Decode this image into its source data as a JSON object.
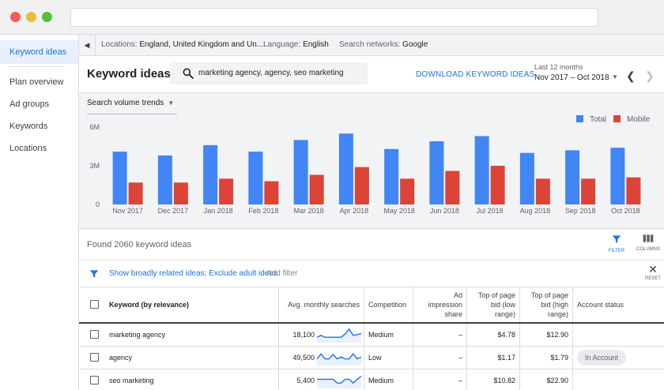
{
  "sidebar": {
    "items": [
      {
        "label": "Keyword ideas",
        "active": true
      },
      {
        "label": "Plan overview"
      },
      {
        "label": "Ad groups"
      },
      {
        "label": "Keywords"
      },
      {
        "label": "Locations"
      }
    ]
  },
  "infobar": {
    "locations_label": "Locations:",
    "locations_value": "England, United Kingdom and Un...",
    "language_label": "Language:",
    "language_value": "English",
    "networks_label": "Search networks:",
    "networks_value": "Google"
  },
  "header": {
    "title": "Keyword ideas",
    "search_value": "marketing agency, agency, seo marketing",
    "download_label": "DOWNLOAD KEYWORD IDEAS",
    "range_label": "Last 12 months",
    "range_value": "Nov 2017 – Oct 2018"
  },
  "chart_panel": {
    "metric_select": "Search volume trends"
  },
  "chart_data": {
    "type": "bar",
    "categories": [
      "Nov 2017",
      "Dec 2017",
      "Jan 2018",
      "Feb 2018",
      "Mar 2018",
      "Apr 2018",
      "May 2018",
      "Jun 2018",
      "Jul 2018",
      "Aug 2018",
      "Sep 2018",
      "Oct 2018"
    ],
    "series": [
      {
        "name": "Total",
        "color": "#4285f4",
        "values": [
          4.1,
          3.8,
          4.6,
          4.1,
          5.0,
          5.5,
          4.3,
          4.9,
          5.3,
          4.0,
          4.2,
          4.4
        ]
      },
      {
        "name": "Mobile",
        "color": "#db4437",
        "values": [
          1.7,
          1.7,
          2.0,
          1.8,
          2.3,
          2.9,
          2.0,
          2.6,
          3.0,
          2.0,
          2.0,
          2.1
        ]
      }
    ],
    "y_ticks": [
      "0",
      "3M",
      "6M"
    ],
    "y_tick_values": [
      0,
      3,
      6
    ],
    "ylim": [
      0,
      6
    ],
    "y_unit": "millions",
    "grid": false,
    "legend_position": "top-right"
  },
  "results": {
    "count_text": "Found 2060 keyword ideas",
    "filter_label": "FILTER",
    "columns_label": "COLUMNS"
  },
  "filters": {
    "active_chip": "Show broadly related ideas; Exclude adult ideas",
    "add_filter": "Add filter",
    "reset_label": "RESET"
  },
  "table": {
    "headers": {
      "keyword": "Keyword (by relevance)",
      "avg_searches": "Avg. monthly searches",
      "competition": "Competition",
      "ad_share": "Ad impression share",
      "bid_low": "Top of page bid (low range)",
      "bid_high": "Top of page bid (high range)",
      "account_status": "Account status"
    },
    "rows": [
      {
        "keyword": "marketing agency",
        "avg_searches": "18,100",
        "competition": "Medium",
        "ad_share": "–",
        "bid_low": "$4.78",
        "bid_high": "$12.90",
        "account_status": "",
        "trend": [
          0.3,
          0.45,
          0.3,
          0.3,
          0.3,
          0.3,
          0.3,
          0.55,
          0.95,
          0.45,
          0.5,
          0.6
        ]
      },
      {
        "keyword": "agency",
        "avg_searches": "49,500",
        "competition": "Low",
        "ad_share": "–",
        "bid_low": "$1.17",
        "bid_high": "$1.79",
        "account_status": "In Account",
        "trend": [
          0.4,
          0.8,
          0.4,
          0.4,
          0.75,
          0.4,
          0.55,
          0.4,
          0.4,
          0.8,
          0.4,
          0.55
        ]
      },
      {
        "keyword": "seo marketing",
        "avg_searches": "5,400",
        "competition": "Medium",
        "ad_share": "–",
        "bid_low": "$10.82",
        "bid_high": "$22.90",
        "account_status": "",
        "trend": [
          0.6,
          0.6,
          0.6,
          0.6,
          0.6,
          0.3,
          0.3,
          0.6,
          0.6,
          0.3,
          0.6,
          0.85
        ]
      }
    ]
  }
}
